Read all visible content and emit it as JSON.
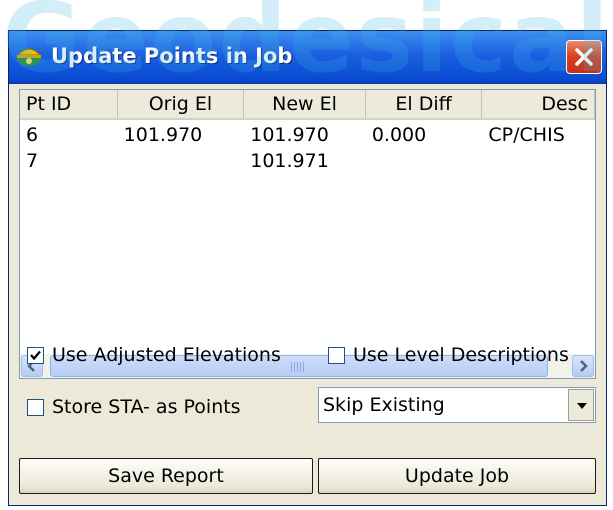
{
  "watermark": {
    "text": "Geodesical"
  },
  "window": {
    "title": "Update Points in Job"
  },
  "table": {
    "columns": [
      "Pt ID",
      "Orig El",
      "New El",
      "El Diff",
      "Desc"
    ],
    "rows": [
      [
        "6",
        "101.970",
        "101.970",
        "0.000",
        "CP/CHIS"
      ],
      [
        "7",
        "",
        "101.971",
        "",
        ""
      ]
    ]
  },
  "options": {
    "use_adjusted_elevations": {
      "label": "Use Adjusted Elevations",
      "checked": true
    },
    "use_level_descriptions": {
      "label": "Use Level Descriptions",
      "checked": false
    },
    "store_sta_as_points": {
      "label": "Store STA- as Points",
      "checked": false
    }
  },
  "existing_mode": {
    "selected": "Skip Existing"
  },
  "buttons": {
    "save_report": "Save Report",
    "update_job": "Update Job"
  },
  "colors": {
    "titlebar": "#1c5fe0",
    "close": "#d9401c",
    "window_bg": "#ece9d8",
    "watermark": "#3fb6e8"
  },
  "icons": {
    "app": "survey-helmet-icon",
    "close": "close-icon",
    "check": "checkmark-icon"
  }
}
